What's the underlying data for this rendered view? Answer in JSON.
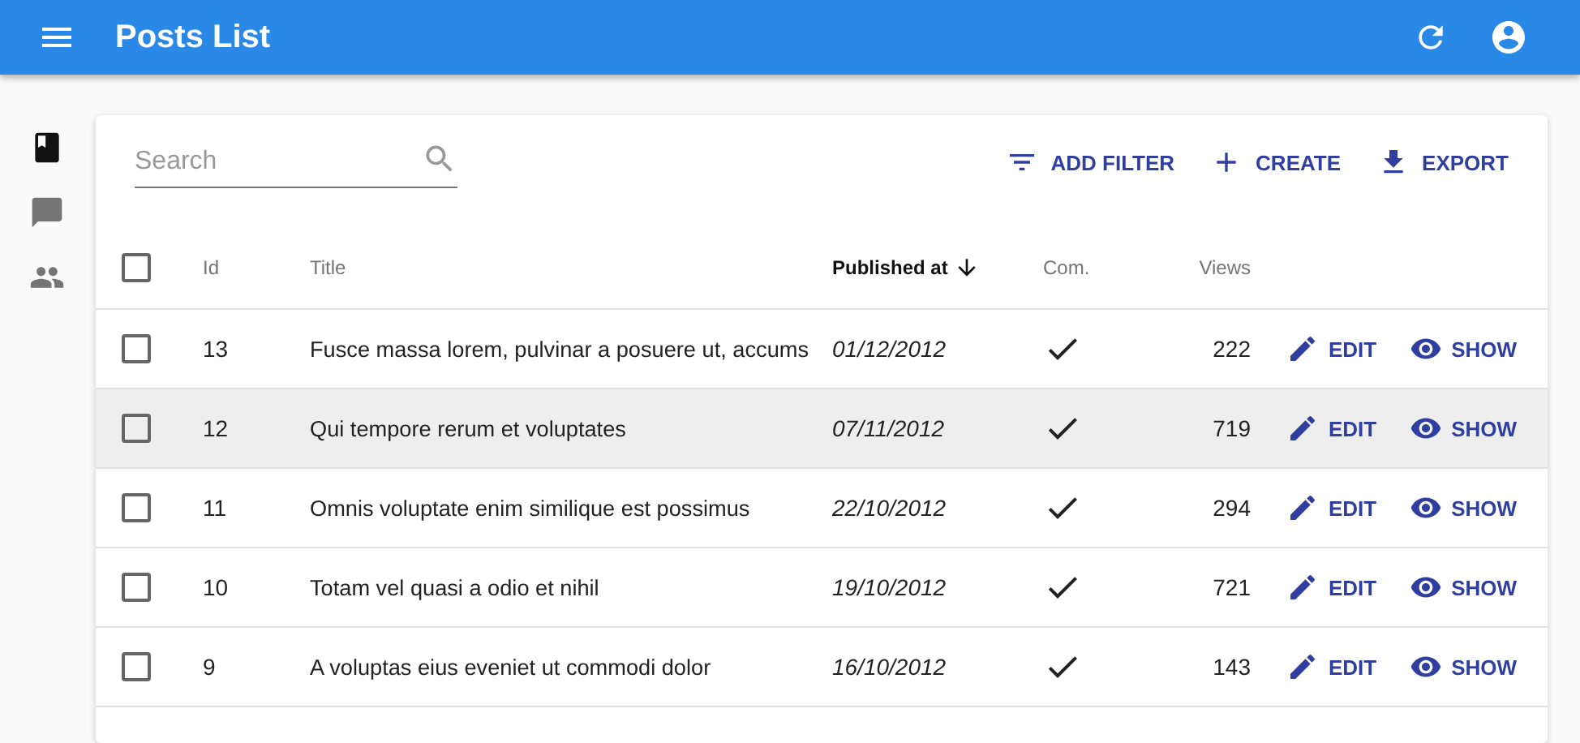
{
  "app_bar": {
    "title": "Posts List"
  },
  "sidebar": {
    "items": [
      {
        "kind": "book",
        "selected": true
      },
      {
        "kind": "comment",
        "selected": false
      },
      {
        "kind": "people",
        "selected": false
      }
    ]
  },
  "search": {
    "placeholder": "Search"
  },
  "actions": [
    {
      "kind": "filter",
      "label": "ADD FILTER"
    },
    {
      "kind": "create",
      "label": "CREATE"
    },
    {
      "kind": "export",
      "label": "EXPORT"
    }
  ],
  "table": {
    "all_selected": false,
    "columns": [
      {
        "label": "Id",
        "sorted": false
      },
      {
        "label": "Title",
        "sorted": false
      },
      {
        "label": "Published at",
        "sorted": true
      },
      {
        "label": "Com.",
        "sorted": false
      },
      {
        "label": "Views",
        "sorted": false
      }
    ],
    "rows": [
      {
        "selected": false,
        "highlighted": false,
        "id": "13",
        "title": "Fusce massa lorem, pulvinar a posuere ut, accums",
        "published": "01/12/2012",
        "commentable": true,
        "views": "222",
        "actions": [
          {
            "kind": "edit",
            "label": "EDIT"
          },
          {
            "kind": "show",
            "label": "SHOW"
          }
        ]
      },
      {
        "selected": false,
        "highlighted": true,
        "id": "12",
        "title": "Qui tempore rerum et voluptates",
        "published": "07/11/2012",
        "commentable": true,
        "views": "719",
        "actions": [
          {
            "kind": "edit",
            "label": "EDIT"
          },
          {
            "kind": "show",
            "label": "SHOW"
          }
        ]
      },
      {
        "selected": false,
        "highlighted": false,
        "id": "11",
        "title": "Omnis voluptate enim similique est possimus",
        "published": "22/10/2012",
        "commentable": true,
        "views": "294",
        "actions": [
          {
            "kind": "edit",
            "label": "EDIT"
          },
          {
            "kind": "show",
            "label": "SHOW"
          }
        ]
      },
      {
        "selected": false,
        "highlighted": false,
        "id": "10",
        "title": "Totam vel quasi a odio et nihil",
        "published": "19/10/2012",
        "commentable": true,
        "views": "721",
        "actions": [
          {
            "kind": "edit",
            "label": "EDIT"
          },
          {
            "kind": "show",
            "label": "SHOW"
          }
        ]
      },
      {
        "selected": false,
        "highlighted": false,
        "id": "9",
        "title": "A voluptas eius eveniet ut commodi dolor",
        "published": "16/10/2012",
        "commentable": true,
        "views": "143",
        "actions": [
          {
            "kind": "edit",
            "label": "EDIT"
          },
          {
            "kind": "show",
            "label": "SHOW"
          }
        ]
      }
    ]
  }
}
